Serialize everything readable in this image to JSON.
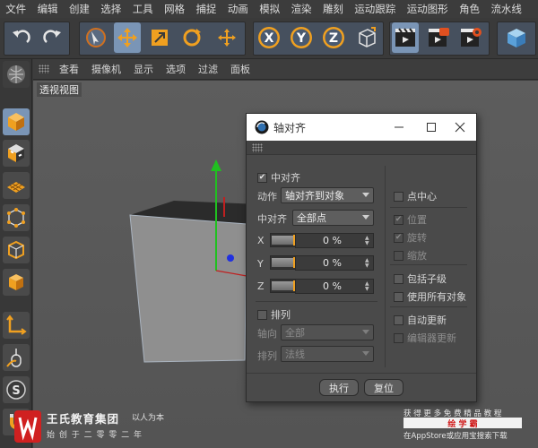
{
  "menubar": [
    "文件",
    "编辑",
    "创建",
    "选择",
    "工具",
    "网格",
    "捕捉",
    "动画",
    "模拟",
    "渲染",
    "雕刻",
    "运动跟踪",
    "运动图形",
    "角色",
    "流水线"
  ],
  "viewport_menu": [
    "查看",
    "摄像机",
    "显示",
    "选项",
    "过滤",
    "面板"
  ],
  "viewport_title": "透视视图",
  "toolbar_icons": [
    "undo-icon",
    "redo-icon",
    "live-select-icon",
    "move-icon",
    "scale-icon",
    "rotate-icon",
    "recent-tool-icon",
    "x-axis-lock-icon",
    "y-axis-lock-icon",
    "z-axis-lock-icon",
    "coordinate-system-icon",
    "render-view-icon",
    "render-picture-viewer-icon",
    "render-settings-icon",
    "cube-primitive-icon"
  ],
  "axis_labels": [
    "X",
    "Y",
    "Z"
  ],
  "dialog": {
    "title": "轴对齐",
    "center_label": "中对齐",
    "action_label": "动作",
    "action_value": "轴对齐到对象",
    "align_label": "中对齐",
    "align_value": "全部点",
    "x_label": "X",
    "y_label": "Y",
    "z_label": "Z",
    "x_value": "0 %",
    "y_value": "0 %",
    "z_value": "0 %",
    "arrange_label": "排列",
    "axis_label": "轴向",
    "axis_value": "全部",
    "order_label": "排列",
    "order_value": "法线",
    "right": {
      "point_center": "点中心",
      "position": "位置",
      "rotation": "旋转",
      "scale": "缩放",
      "include_children": "包括子级",
      "use_all_objects": "使用所有对象",
      "auto_update": "自动更新",
      "editor_update": "编辑器更新"
    },
    "execute_button": "执行",
    "reset_button": "复位"
  },
  "watermark_left": {
    "name": "王氏教育集团",
    "slogan": "以人为本",
    "tagline": "始 创 于 二 零 零 二 年"
  },
  "watermark_right": {
    "line1": "获 得 更 多 免 费 精 品 教 程",
    "brand": "绘 学 霸",
    "line3": "在AppStore或应用宝搜索下载"
  }
}
